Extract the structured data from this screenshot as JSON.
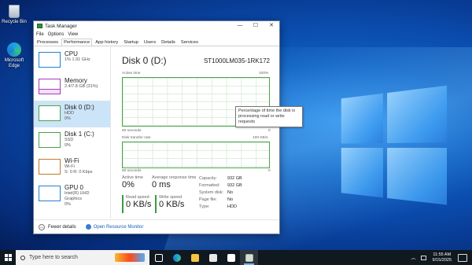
{
  "desktop": {
    "icons": [
      {
        "label": "Recycle Bin",
        "icon": "recycle-bin-icon"
      },
      {
        "label": "Microsoft Edge",
        "icon": "edge-icon"
      }
    ]
  },
  "window": {
    "title": "Task Manager",
    "menu": [
      "File",
      "Options",
      "View"
    ],
    "tabs": [
      "Processes",
      "Performance",
      "App history",
      "Startup",
      "Users",
      "Details",
      "Services"
    ],
    "active_tab": "Performance",
    "sidebar": [
      {
        "name": "CPU",
        "line1": "1% 1.91 GHz",
        "line2": "",
        "color": "#1a82d8"
      },
      {
        "name": "Memory",
        "line1": "2.4/7.8 GB (31%)",
        "line2": "",
        "color": "#a63cb8"
      },
      {
        "name": "Disk 0 (D:)",
        "line1": "HDD",
        "line2": "0%",
        "color": "#4da24d"
      },
      {
        "name": "Disk 1 (C:)",
        "line1": "SSD",
        "line2": "0%",
        "color": "#4da24d"
      },
      {
        "name": "Wi-Fi",
        "line1": "Wi-Fi",
        "line2": "S: 0 R: 0 Kbps",
        "color": "#c07a2b"
      },
      {
        "name": "GPU 0",
        "line1": "Intel(R) UHD Graphics",
        "line2": "0%",
        "color": "#2a7fd4"
      }
    ],
    "selected": "Disk 0 (D:)",
    "main": {
      "title": "Disk 0 (D:)",
      "model": "ST1000LM035-1RK172",
      "graph1": {
        "top_left": "Active time",
        "top_right": "100%",
        "bottom_left": "60 seconds",
        "bottom_right": "0"
      },
      "graph2": {
        "top_left": "Disk transfer rate",
        "top_right": "100 KB/s",
        "bottom_left": "60 seconds",
        "bottom_right": "0"
      },
      "tooltip": "Percentage of time the disk is processing read or write requests",
      "active_time": {
        "label": "Active time",
        "value": "0%"
      },
      "avg_response": {
        "label": "Average response time",
        "value": "0 ms"
      },
      "read_speed": {
        "label": "Read speed",
        "value": "0 KB/s"
      },
      "write_speed": {
        "label": "Write speed",
        "value": "0 KB/s"
      },
      "properties": [
        {
          "key": "Capacity:",
          "value": "932 GB"
        },
        {
          "key": "Formatted:",
          "value": "932 GB"
        },
        {
          "key": "System disk:",
          "value": "No"
        },
        {
          "key": "Page file:",
          "value": "No"
        },
        {
          "key": "Type:",
          "value": "HDD"
        }
      ]
    },
    "footer": {
      "fewer": "Fewer details",
      "monitor": "Open Resource Monitor"
    }
  },
  "taskbar": {
    "search_placeholder": "Type here to search",
    "apps": [
      "task-view-icon",
      "edge-icon",
      "file-explorer-icon",
      "store-icon",
      "mail-icon",
      "task-manager-icon"
    ],
    "time": "11:55 AM",
    "date": "9/15/2025"
  }
}
